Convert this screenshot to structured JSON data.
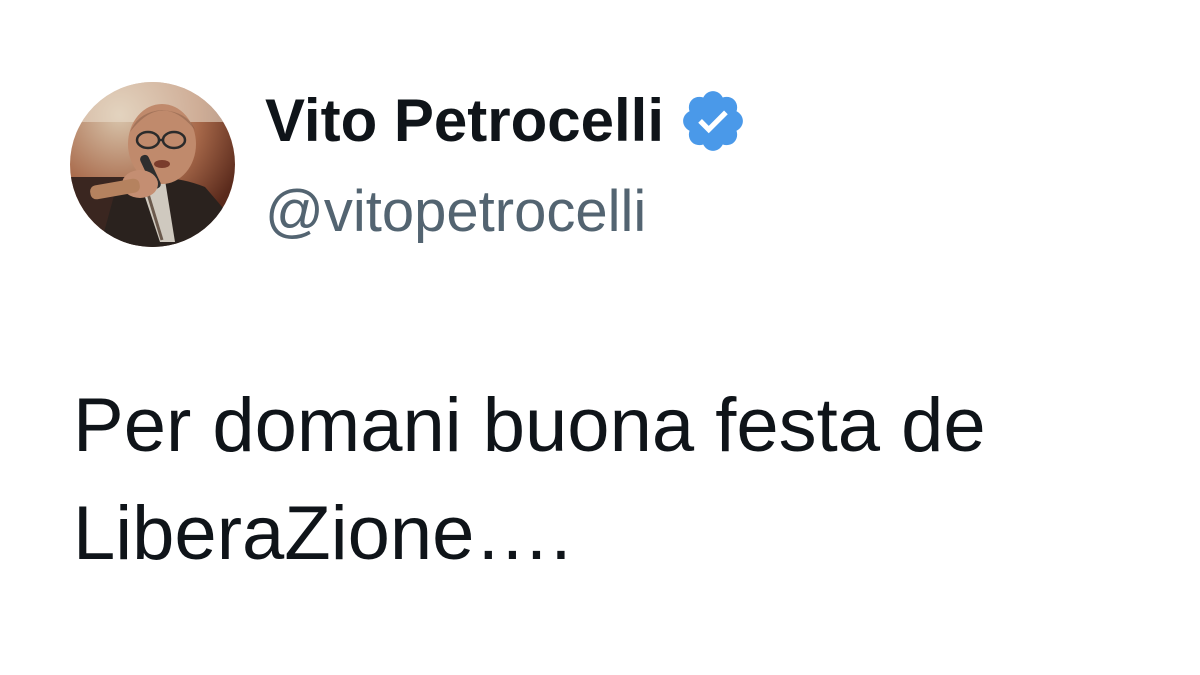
{
  "tweet": {
    "author": {
      "display_name": "Vito Petrocelli",
      "handle": "@vitopetrocelli",
      "verified": true,
      "verified_color": "#4a99e9"
    },
    "text_lines": [
      "Per domani buona festa de",
      "LiberaZione…."
    ]
  }
}
